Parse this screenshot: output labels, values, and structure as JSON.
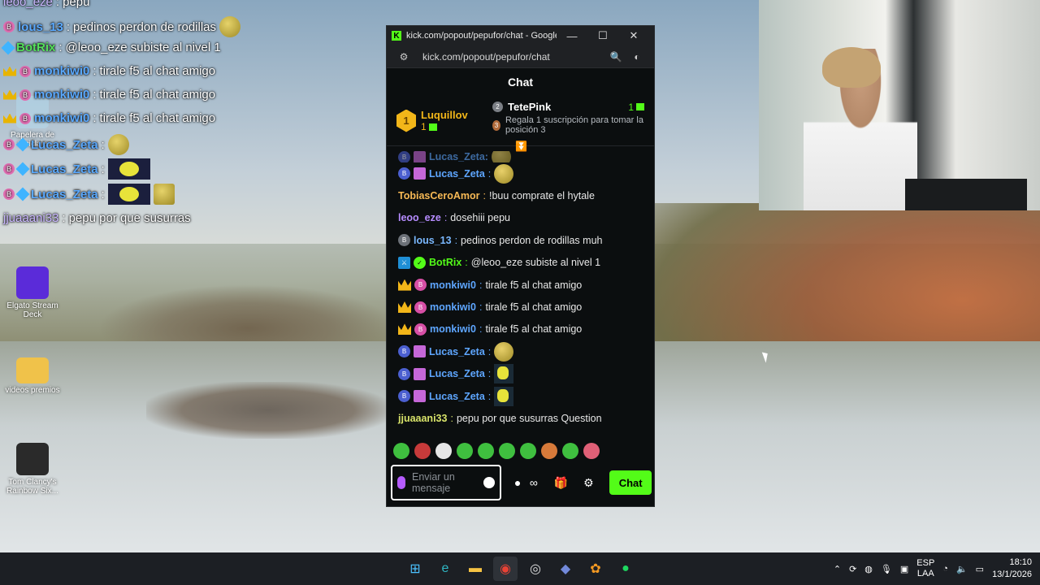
{
  "overlay_chat": [
    {
      "user": "leoo_eze",
      "text": "pepu",
      "color": "#c9b6ff"
    },
    {
      "user": "lous_13",
      "text": "pedinos perdon de rodillas",
      "color": "#5aa9ff"
    },
    {
      "user": "BotRix",
      "text": "@leoo_eze subiste al nivel 1",
      "color": "#54e05a"
    },
    {
      "user": "monkiwi0",
      "text": "tirale f5 al chat amigo",
      "color": "#5aa9ff"
    },
    {
      "user": "monkiwi0",
      "text": "tirale f5 al chat amigo",
      "color": "#5aa9ff"
    },
    {
      "user": "monkiwi0",
      "text": "tirale f5 al chat amigo",
      "color": "#5aa9ff"
    },
    {
      "user": "Lucas_Zeta",
      "text": "",
      "color": "#5aa9ff"
    },
    {
      "user": "Lucas_Zeta",
      "text": "",
      "color": "#5aa9ff"
    },
    {
      "user": "Lucas_Zeta",
      "text": "",
      "color": "#5aa9ff"
    },
    {
      "user": "jjuaaani33",
      "text": "pepu por que susurras",
      "color": "#c9b6ff"
    }
  ],
  "desktop_icons": [
    {
      "label": "Papelera de reciclaje"
    },
    {
      "label": "Elgato Stream Deck"
    },
    {
      "label": "videos premios"
    },
    {
      "label": "Tom Clancy's Rainbow Six..."
    }
  ],
  "browser": {
    "title": "kick.com/popout/pepufor/chat - Google C...",
    "url": "kick.com/popout/pepufor/chat",
    "minimize": "—",
    "maximize": "☐",
    "close": "✕"
  },
  "chat": {
    "header": "Chat",
    "leaderboard": {
      "first": {
        "rank": "1",
        "name": "Luquillov",
        "count": "1"
      },
      "second": {
        "rank": "2",
        "name": "TetePink",
        "count": "1"
      },
      "third": {
        "rank": "3",
        "text": "Regala 1 suscripción para tomar la posición 3"
      }
    },
    "messages": [
      {
        "user": "Lucas_Zeta",
        "text": "",
        "color": "#5ea6ff",
        "badges": [
          "blue",
          "gift"
        ],
        "emote": "round"
      },
      {
        "user": "TobiasCeroAmor",
        "text": "!buu comprate el hytale",
        "color": "#f7b955",
        "badges": [],
        "emote": ""
      },
      {
        "user": "leoo_eze",
        "text": "dosehiii pepu",
        "color": "#b68cff",
        "badges": [],
        "emote": ""
      },
      {
        "user": "lous_13",
        "text": "pedinos perdon de rodillas muh",
        "color": "#7ab8ff",
        "badges": [
          "gray"
        ],
        "emote": ""
      },
      {
        "user": "BotRix",
        "text": "@leoo_eze subiste al nivel 1",
        "color": "#53fc18",
        "badges": [
          "mod",
          "verified"
        ],
        "emote": ""
      },
      {
        "user": "monkiwi0",
        "text": "tirale f5 al chat amigo",
        "color": "#5ea6ff",
        "badges": [
          "crown",
          "pink"
        ],
        "emote": ""
      },
      {
        "user": "monkiwi0",
        "text": "tirale f5 al chat amigo",
        "color": "#5ea6ff",
        "badges": [
          "crown",
          "pink"
        ],
        "emote": ""
      },
      {
        "user": "monkiwi0",
        "text": "tirale f5 al chat amigo",
        "color": "#5ea6ff",
        "badges": [
          "crown",
          "pink"
        ],
        "emote": ""
      },
      {
        "user": "Lucas_Zeta",
        "text": "",
        "color": "#5ea6ff",
        "badges": [
          "blue",
          "gift"
        ],
        "emote": "round"
      },
      {
        "user": "Lucas_Zeta",
        "text": "",
        "color": "#5ea6ff",
        "badges": [
          "blue",
          "gift"
        ],
        "emote": "square"
      },
      {
        "user": "Lucas_Zeta",
        "text": "",
        "color": "#5ea6ff",
        "badges": [
          "blue",
          "gift"
        ],
        "emote": "square"
      },
      {
        "user": "jjuaaani33",
        "text": "pepu por que susurras Question",
        "color": "#d8e36a",
        "badges": [],
        "emote": ""
      }
    ],
    "input_placeholder": "Enviar un mensaje",
    "send_label": "Chat",
    "infinity_label": "∞"
  },
  "taskbar": {
    "apps": [
      "start",
      "edge",
      "files",
      "chrome",
      "obs",
      "discord",
      "fl-studio",
      "spotify"
    ],
    "lang_top": "ESP",
    "lang_bottom": "LAA",
    "time": "18:10",
    "date": "13/1/2026"
  }
}
